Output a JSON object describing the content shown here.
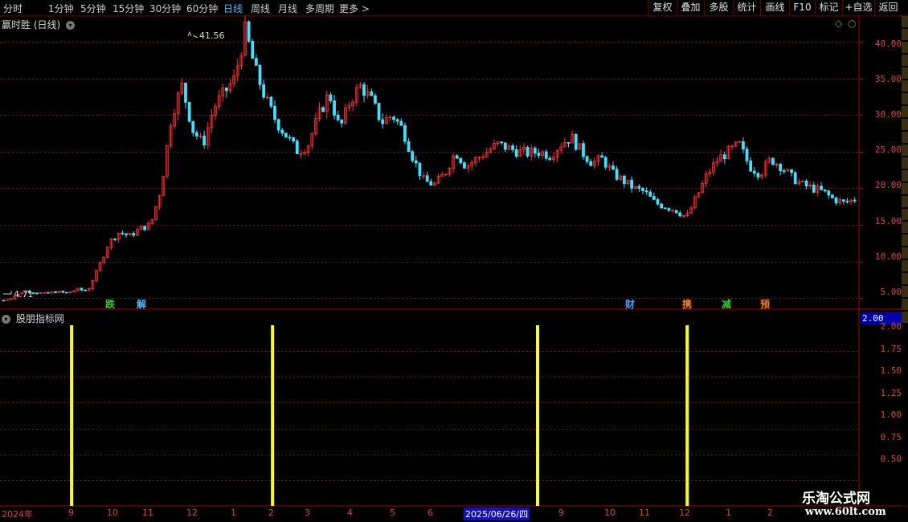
{
  "toolbar": {
    "timeframes": [
      "分时",
      "1分钟",
      "5分钟",
      "15分钟",
      "30分钟",
      "60分钟",
      "日线",
      "周线",
      "月线",
      "多周期",
      "更多 >"
    ],
    "active_timeframe": "日线",
    "buttons": [
      "复权",
      "叠加",
      "多股",
      "统计",
      "画线",
      "F10",
      "标记",
      "+自选",
      "返回"
    ]
  },
  "chart_header": {
    "title": "赢时胜",
    "period": "(日线)"
  },
  "indicator_header": {
    "title": "股朋指标网"
  },
  "price_axis": {
    "ticks": [
      "40.00",
      "35.00",
      "30.00",
      "25.00",
      "20.00",
      "15.00",
      "10.00",
      "5.00"
    ]
  },
  "indicator_axis": {
    "ticks": [
      "2.00",
      "1.75",
      "1.50",
      "1.25",
      "1.00",
      "0.75",
      "0.50"
    ],
    "current_value": "2.00"
  },
  "annotations": {
    "high": "41.56",
    "low": "4.71"
  },
  "signals": [
    {
      "text": "跌",
      "color": "#30d030"
    },
    {
      "text": "解",
      "color": "#40c0ff"
    },
    {
      "text": "财",
      "color": "#40a0ff"
    },
    {
      "text": "携",
      "color": "#ff8000"
    },
    {
      "text": "减",
      "color": "#30d030"
    },
    {
      "text": "预",
      "color": "#ff8000"
    }
  ],
  "x_axis": {
    "labels": [
      "2024年",
      "9",
      "10",
      "11",
      "12",
      "1",
      "2",
      "3",
      "4",
      "5",
      "6",
      "2025/06/26/四",
      "9",
      "10",
      "11",
      "12",
      "1",
      "2"
    ]
  },
  "watermark": {
    "line1": "乐淘公式网",
    "line2": "www.60lt.com"
  },
  "chart_data": {
    "type": "candlestick",
    "title": "赢时胜 (日线)",
    "y_range": [
      3.5,
      43.5
    ],
    "close_series_approx": [
      4.71,
      5.2,
      6.0,
      5.8,
      5.6,
      5.9,
      5.7,
      6.2,
      6.0,
      9.0,
      12.5,
      14.0,
      13.5,
      14.5,
      15.0,
      20.0,
      30.0,
      34.0,
      28.0,
      26.0,
      31.0,
      33.0,
      35.0,
      41.56,
      36.0,
      32.0,
      29.0,
      27.0,
      25.0,
      26.0,
      30.0,
      33.0,
      28.0,
      32.0,
      34.0,
      32.0,
      29.0,
      30.0,
      28.0,
      24.0,
      21.0,
      20.5,
      22.0,
      25.0,
      23.0,
      24.0,
      25.0,
      26.0,
      25.5,
      25.0,
      24.8,
      25.0,
      24.5,
      26.0,
      27.0,
      25.0,
      23.5,
      24.0,
      22.0,
      21.0,
      20.0,
      19.5,
      18.0,
      17.5,
      17.0,
      16.0,
      19.0,
      22.0,
      24.0,
      25.0,
      26.0,
      23.0,
      22.0,
      24.0,
      23.0,
      21.5,
      20.5,
      20.0,
      19.5,
      18.5,
      18.0,
      18.5
    ],
    "indicator": {
      "name": "股朋指标网",
      "type": "bar",
      "y_range": [
        0.5,
        2.0
      ],
      "signal_value": 2.0,
      "signal_count": 4
    }
  }
}
